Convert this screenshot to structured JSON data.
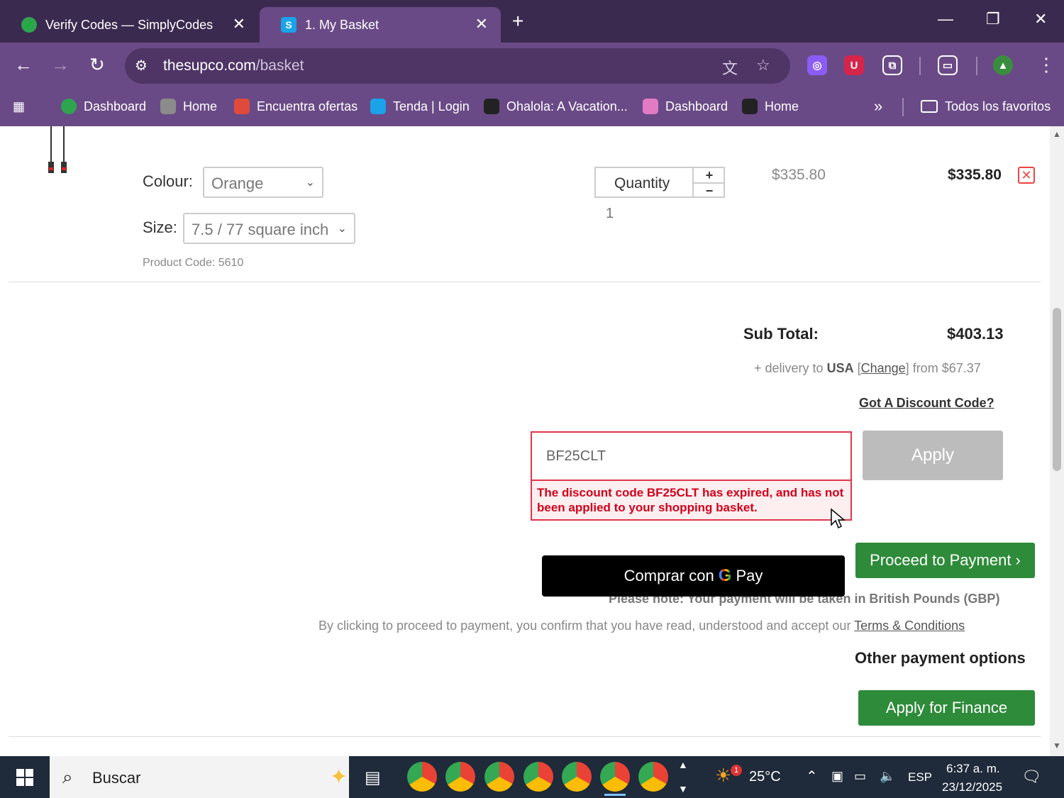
{
  "browser": {
    "tabs": [
      {
        "title": "Verify Codes — SimplyCodes",
        "active": false
      },
      {
        "title": "1. My Basket",
        "active": true
      }
    ],
    "url_host": "thesupco.com",
    "url_path": "/basket",
    "bookmarks": [
      {
        "label": "Dashboard",
        "color": "#2ea44f"
      },
      {
        "label": "Home",
        "color": "#8b8b8b"
      },
      {
        "label": "Encuentra ofertas",
        "color": "#e04a3a"
      },
      {
        "label": "Tenda | Login",
        "color": "#1aa3e8"
      },
      {
        "label": "Ohalola: A Vacation...",
        "color": "#222"
      },
      {
        "label": "Dashboard",
        "color": "#e27ac4"
      },
      {
        "label": "Home",
        "color": "#222"
      }
    ],
    "all_bookmarks_label": "Todos los favoritos"
  },
  "product": {
    "colour_label": "Colour:",
    "colour_value": "Orange",
    "size_label": "Size:",
    "size_value": "7.5 / 77 square inch",
    "product_code": "Product Code: 5610",
    "quantity_label": "Quantity",
    "quantity_value": "1",
    "unit_price": "$335.80",
    "line_total": "$335.80"
  },
  "summary": {
    "subtotal_label": "Sub Total:",
    "subtotal_value": "$403.13",
    "delivery_prefix": "+ delivery to",
    "delivery_country": "USA",
    "change_link": "Change",
    "delivery_suffix": "from $67.37",
    "discount_link": "Got A Discount Code?",
    "discount_code": "BF25CLT",
    "discount_error": "The discount code BF25CLT has expired, and has not been applied to your shopping basket.",
    "apply_label": "Apply",
    "gpay_prefix": "Comprar con",
    "gpay_g": "G",
    "gpay_pay": "Pay",
    "proceed_label": "Proceed to Payment ›",
    "note": "Please note: Your payment will be taken in British Pounds (GBP)",
    "terms_prefix": "By clicking to proceed to payment, you confirm that you have read, understood and accept our",
    "terms_link": "Terms & Conditions",
    "other_options": "Other payment options",
    "finance_label": "Apply for Finance"
  },
  "taskbar": {
    "search_placeholder": "Buscar",
    "weather": "25°C",
    "weather_badge": "1",
    "language": "ESP",
    "time": "6:37 a. m.",
    "date": "23/12/2025"
  }
}
